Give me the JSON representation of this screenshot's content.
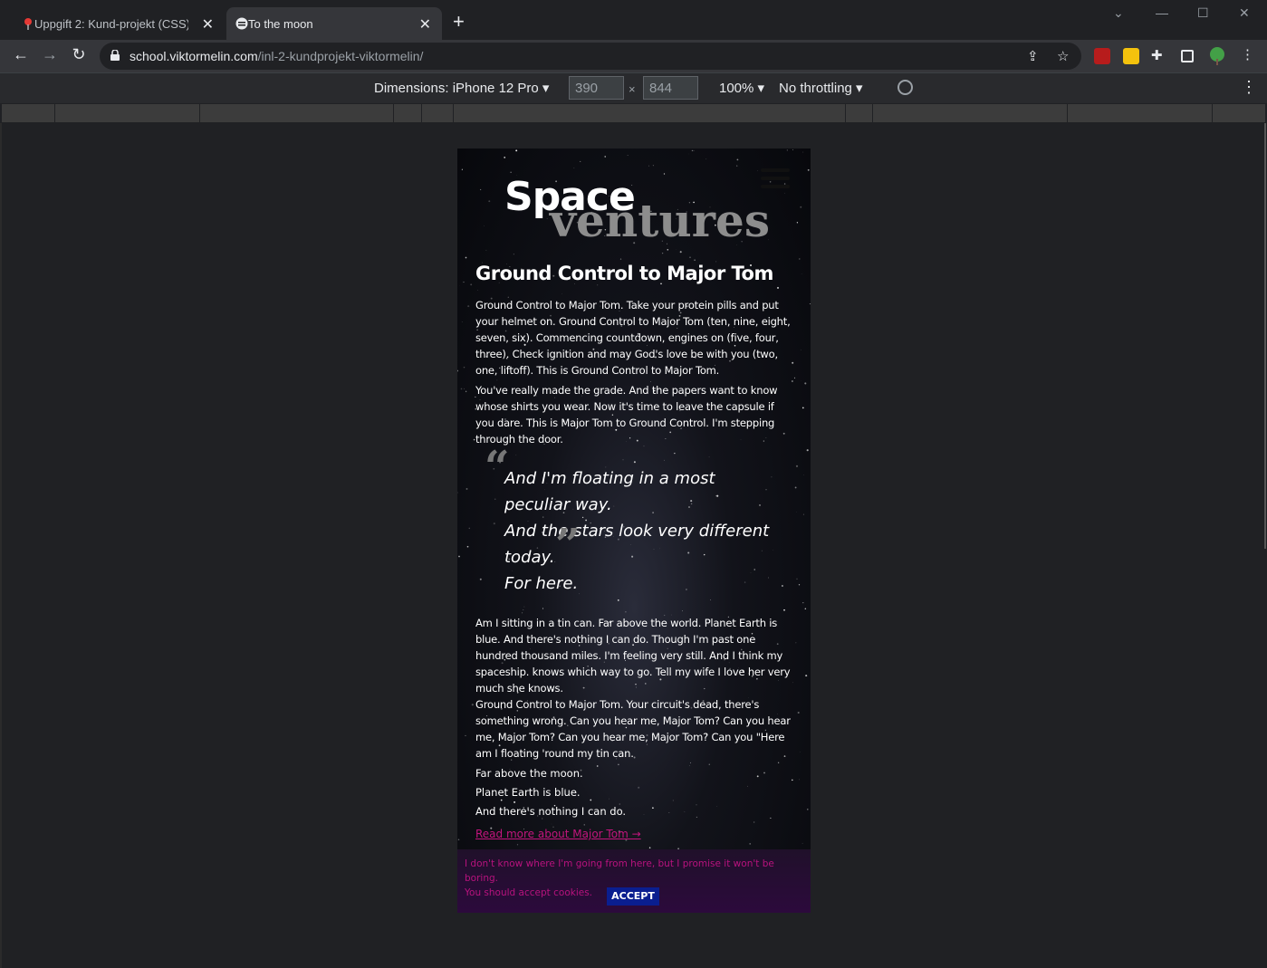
{
  "browser": {
    "tabs": [
      {
        "title": "Uppgift 2: Kund-projekt (CSS) | H",
        "active": false,
        "icon": "pin-icon"
      },
      {
        "title": "To the moon",
        "active": true,
        "icon": "site-icon"
      }
    ],
    "new_tab_label": "+",
    "url_host": "school.viktormelin.com",
    "url_path": "/inl-2-kundprojekt-viktormelin/"
  },
  "devtools": {
    "dimensions_label": "Dimensions: iPhone 12 Pro",
    "width": "390",
    "height": "844",
    "separator": "×",
    "zoom": "100%",
    "throttling": "No throttling"
  },
  "page": {
    "brand_word1": "Space",
    "brand_word2": "ventures",
    "heading": "Ground Control to Major Tom",
    "paragraphs": [
      "Ground Control to Major Tom. Take your protein pills and put your helmet on. Ground Control to Major Tom (ten, nine, eight, seven, six). Commencing countdown, engines on (five, four, three). Check ignition and may God's love be with you (two, one, liftoff). This is Ground Control to Major Tom.",
      "You've really made the grade. And the papers want to know whose shirts you wear. Now it's time to leave the capsule if you dare. This is Major Tom to Ground Control. I'm stepping through the door."
    ],
    "quote_lines": [
      "And I'm floating in a most peculiar way.",
      "And the stars look very different today.",
      "For here."
    ],
    "paragraph3": "Am I sitting in a tin can. Far above the world. Planet Earth is blue. And there's nothing I can do. Though I'm past one hundred thousand miles. I'm feeling very still. And I think my spaceship. knows which way to go. Tell my wife I love her very much she knows.",
    "paragraph4": "Ground Control to Major Tom. Your circuit's dead, there's something wrong. Can you hear me, Major Tom? Can you hear me, Major Tom? Can you hear me, Major Tom? Can you \"Here am I floating 'round my tin can.",
    "short_lines": [
      "Far above the moon.",
      "Planet Earth is blue.",
      "And there's nothing I can do."
    ],
    "read_more": "Read more about Major Tom →",
    "cookie_line1": "I don't know where I'm going from here, but I promise it won't be boring.",
    "cookie_line2": "You should accept cookies.",
    "accept_label": "ACCEPT"
  },
  "colors": {
    "accent_link": "#c3157e",
    "accept_button": "#0a1e8f"
  }
}
